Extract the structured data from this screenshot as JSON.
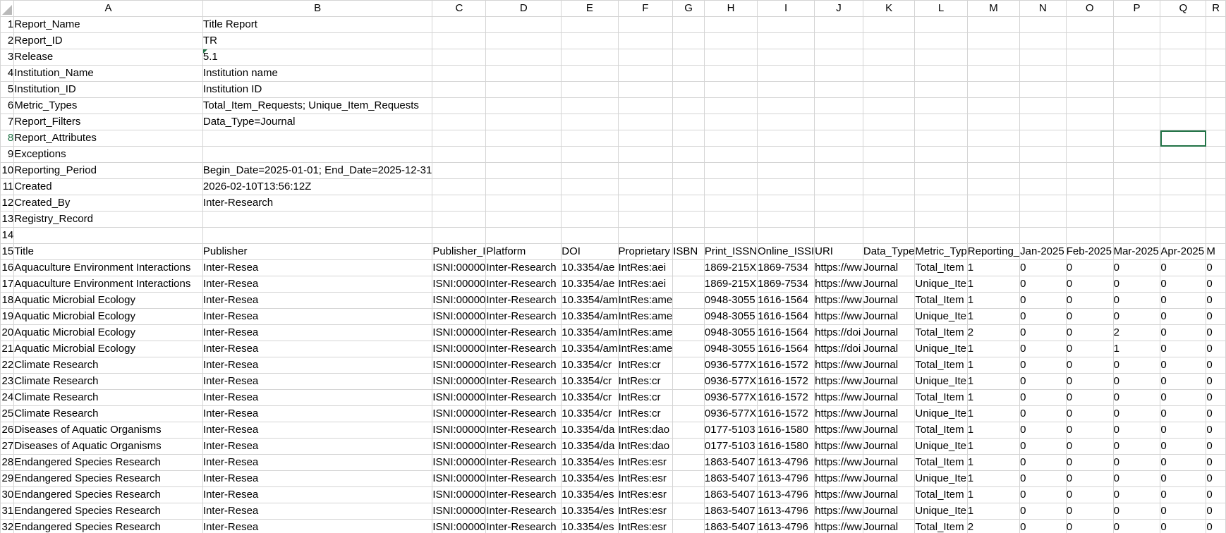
{
  "columns": [
    "A",
    "B",
    "C",
    "D",
    "E",
    "F",
    "G",
    "H",
    "I",
    "J",
    "K",
    "L",
    "M",
    "N",
    "O",
    "P",
    "Q",
    "R"
  ],
  "selected_row": 8,
  "metadata_rows": [
    {
      "n": "1",
      "a": "Report_Name",
      "b": "Title Report"
    },
    {
      "n": "2",
      "a": "Report_ID",
      "b": "TR"
    },
    {
      "n": "3",
      "a": "Release",
      "b": "5.1"
    },
    {
      "n": "4",
      "a": "Institution_Name",
      "b": "Institution name"
    },
    {
      "n": "5",
      "a": "Institution_ID",
      "b": "Institution ID"
    },
    {
      "n": "6",
      "a": "Metric_Types",
      "b": "Total_Item_Requests; Unique_Item_Requests"
    },
    {
      "n": "7",
      "a": "Report_Filters",
      "b": "Data_Type=Journal"
    },
    {
      "n": "8",
      "a": "Report_Attributes",
      "b": ""
    },
    {
      "n": "9",
      "a": "Exceptions",
      "b": ""
    },
    {
      "n": "10",
      "a": "Reporting_Period",
      "b": "Begin_Date=2025-01-01; End_Date=2025-12-31"
    },
    {
      "n": "11",
      "a": "Created",
      "b": "2026-02-10T13:56:12Z"
    },
    {
      "n": "12",
      "a": "Created_By",
      "b": "Inter-Research"
    },
    {
      "n": "13",
      "a": "Registry_Record",
      "b": ""
    },
    {
      "n": "14",
      "a": "",
      "b": ""
    }
  ],
  "header_row": {
    "n": "15",
    "cells": [
      "Title",
      "Publisher",
      "Publisher_I",
      "Platform",
      "DOI",
      "Proprietary",
      "ISBN",
      "Print_ISSN",
      "Online_ISSI",
      "URI",
      "Data_Type",
      "Metric_Typ",
      "Reporting_",
      "Jan-2025",
      "Feb-2025",
      "Mar-2025",
      "Apr-2025",
      "M"
    ]
  },
  "data_rows": [
    {
      "n": "16",
      "cells": [
        "Aquaculture Environment Interactions",
        "Inter-Resea",
        "ISNI:00000",
        "Inter-Research",
        "10.3354/ae",
        "IntRes:aei",
        "",
        "1869-215X",
        "1869-7534",
        "https://ww",
        "Journal",
        "Total_Item",
        "1",
        "0",
        "0",
        "0",
        "0",
        "0"
      ]
    },
    {
      "n": "17",
      "cells": [
        "Aquaculture Environment Interactions",
        "Inter-Resea",
        "ISNI:00000",
        "Inter-Research",
        "10.3354/ae",
        "IntRes:aei",
        "",
        "1869-215X",
        "1869-7534",
        "https://ww",
        "Journal",
        "Unique_Ite",
        "1",
        "0",
        "0",
        "0",
        "0",
        "0"
      ]
    },
    {
      "n": "18",
      "cells": [
        "Aquatic Microbial Ecology",
        "Inter-Resea",
        "ISNI:00000",
        "Inter-Research",
        "10.3354/am",
        "IntRes:ame",
        "",
        "0948-3055",
        "1616-1564",
        "https://ww",
        "Journal",
        "Total_Item",
        "1",
        "0",
        "0",
        "0",
        "0",
        "0"
      ]
    },
    {
      "n": "19",
      "cells": [
        "Aquatic Microbial Ecology",
        "Inter-Resea",
        "ISNI:00000",
        "Inter-Research",
        "10.3354/am",
        "IntRes:ame",
        "",
        "0948-3055",
        "1616-1564",
        "https://ww",
        "Journal",
        "Unique_Ite",
        "1",
        "0",
        "0",
        "0",
        "0",
        "0"
      ]
    },
    {
      "n": "20",
      "cells": [
        "Aquatic Microbial Ecology",
        "Inter-Resea",
        "ISNI:00000",
        "Inter-Research",
        "10.3354/am",
        "IntRes:ame",
        "",
        "0948-3055",
        "1616-1564",
        "https://doi",
        "Journal",
        "Total_Item",
        "2",
        "0",
        "0",
        "2",
        "0",
        "0"
      ]
    },
    {
      "n": "21",
      "cells": [
        "Aquatic Microbial Ecology",
        "Inter-Resea",
        "ISNI:00000",
        "Inter-Research",
        "10.3354/am",
        "IntRes:ame",
        "",
        "0948-3055",
        "1616-1564",
        "https://doi",
        "Journal",
        "Unique_Ite",
        "1",
        "0",
        "0",
        "1",
        "0",
        "0"
      ]
    },
    {
      "n": "22",
      "cells": [
        "Climate Research",
        "Inter-Resea",
        "ISNI:00000",
        "Inter-Research",
        "10.3354/cr",
        "IntRes:cr",
        "",
        "0936-577X",
        "1616-1572",
        "https://ww",
        "Journal",
        "Total_Item",
        "1",
        "0",
        "0",
        "0",
        "0",
        "0"
      ]
    },
    {
      "n": "23",
      "cells": [
        "Climate Research",
        "Inter-Resea",
        "ISNI:00000",
        "Inter-Research",
        "10.3354/cr",
        "IntRes:cr",
        "",
        "0936-577X",
        "1616-1572",
        "https://ww",
        "Journal",
        "Unique_Ite",
        "1",
        "0",
        "0",
        "0",
        "0",
        "0"
      ]
    },
    {
      "n": "24",
      "cells": [
        "Climate Research",
        "Inter-Resea",
        "ISNI:00000",
        "Inter-Research",
        "10.3354/cr",
        "IntRes:cr",
        "",
        "0936-577X",
        "1616-1572",
        "https://ww",
        "Journal",
        "Total_Item",
        "1",
        "0",
        "0",
        "0",
        "0",
        "0"
      ]
    },
    {
      "n": "25",
      "cells": [
        "Climate Research",
        "Inter-Resea",
        "ISNI:00000",
        "Inter-Research",
        "10.3354/cr",
        "IntRes:cr",
        "",
        "0936-577X",
        "1616-1572",
        "https://ww",
        "Journal",
        "Unique_Ite",
        "1",
        "0",
        "0",
        "0",
        "0",
        "0"
      ]
    },
    {
      "n": "26",
      "cells": [
        "Diseases of Aquatic Organisms",
        "Inter-Resea",
        "ISNI:00000",
        "Inter-Research",
        "10.3354/da",
        "IntRes:dao",
        "",
        "0177-5103",
        "1616-1580",
        "https://ww",
        "Journal",
        "Total_Item",
        "1",
        "0",
        "0",
        "0",
        "0",
        "0"
      ]
    },
    {
      "n": "27",
      "cells": [
        "Diseases of Aquatic Organisms",
        "Inter-Resea",
        "ISNI:00000",
        "Inter-Research",
        "10.3354/da",
        "IntRes:dao",
        "",
        "0177-5103",
        "1616-1580",
        "https://ww",
        "Journal",
        "Unique_Ite",
        "1",
        "0",
        "0",
        "0",
        "0",
        "0"
      ]
    },
    {
      "n": "28",
      "cells": [
        "Endangered Species Research",
        "Inter-Resea",
        "ISNI:00000",
        "Inter-Research",
        "10.3354/es",
        "IntRes:esr",
        "",
        "1863-5407",
        "1613-4796",
        "https://ww",
        "Journal",
        "Total_Item",
        "1",
        "0",
        "0",
        "0",
        "0",
        "0"
      ]
    },
    {
      "n": "29",
      "cells": [
        "Endangered Species Research",
        "Inter-Resea",
        "ISNI:00000",
        "Inter-Research",
        "10.3354/es",
        "IntRes:esr",
        "",
        "1863-5407",
        "1613-4796",
        "https://ww",
        "Journal",
        "Unique_Ite",
        "1",
        "0",
        "0",
        "0",
        "0",
        "0"
      ]
    },
    {
      "n": "30",
      "cells": [
        "Endangered Species Research",
        "Inter-Resea",
        "ISNI:00000",
        "Inter-Research",
        "10.3354/es",
        "IntRes:esr",
        "",
        "1863-5407",
        "1613-4796",
        "https://ww",
        "Journal",
        "Total_Item",
        "1",
        "0",
        "0",
        "0",
        "0",
        "0"
      ]
    },
    {
      "n": "31",
      "cells": [
        "Endangered Species Research",
        "Inter-Resea",
        "ISNI:00000",
        "Inter-Research",
        "10.3354/es",
        "IntRes:esr",
        "",
        "1863-5407",
        "1613-4796",
        "https://ww",
        "Journal",
        "Unique_Ite",
        "1",
        "0",
        "0",
        "0",
        "0",
        "0"
      ]
    },
    {
      "n": "32",
      "cells": [
        "Endangered Species Research",
        "Inter-Resea",
        "ISNI:00000",
        "Inter-Research",
        "10.3354/es",
        "IntRes:esr",
        "",
        "1863-5407",
        "1613-4796",
        "https://ww",
        "Journal",
        "Total_Item",
        "2",
        "0",
        "0",
        "0",
        "0",
        "0"
      ]
    }
  ]
}
